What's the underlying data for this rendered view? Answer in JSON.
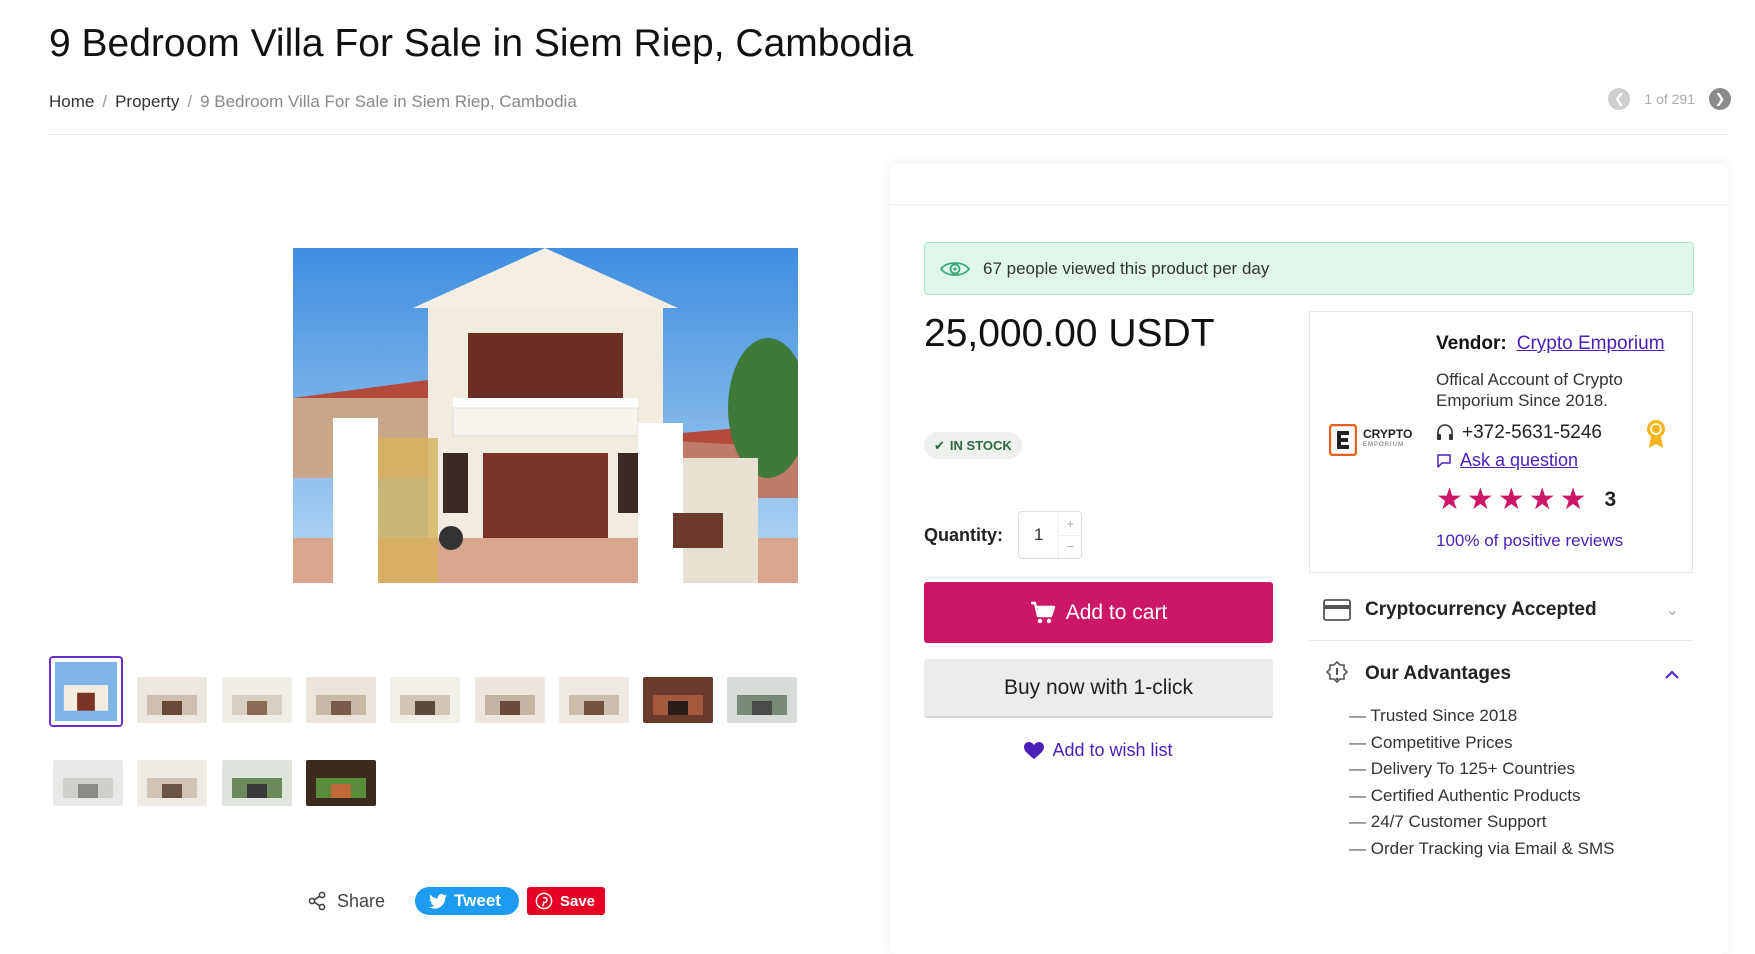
{
  "page": {
    "title": "9 Bedroom Villa For Sale in Siem Riep, Cambodia",
    "breadcrumb": [
      "Home",
      "Property",
      "9 Bedroom Villa For Sale in Siem Riep, Cambodia"
    ],
    "pager": "1 of 291"
  },
  "gallery": {
    "thumb_count": 13,
    "active_index": 0
  },
  "share": {
    "share_label": "Share",
    "tweet_label": "Tweet",
    "save_label": "Save"
  },
  "product": {
    "views_text": "67 people viewed this product per day",
    "price": "25,000.00",
    "currency": "USDT",
    "stock": "IN STOCK",
    "quantity_label": "Quantity:",
    "quantity": "1",
    "add_to_cart": "Add to cart",
    "buy_now": "Buy now with 1-click",
    "wish_list": "Add to wish list"
  },
  "vendor": {
    "label": "Vendor:",
    "name": "Crypto Emporium",
    "description": "Offical Account of Crypto Emporium Since 2018.",
    "phone": "+372-5631-5246",
    "ask": "Ask a question",
    "logo_text": "CRYPTO",
    "logo_subtext": "EMPORIUM",
    "rating_stars": 5,
    "rating_count": "3",
    "positive": "100% of positive reviews"
  },
  "accordion": {
    "crypto_title": "Cryptocurrency Accepted",
    "advantages_title": "Our Advantages",
    "advantages": [
      "Trusted Since 2018",
      "Competitive Prices",
      "Delivery To 125+ Countries",
      "Certified Authentic Products",
      "24/7 Customer Support",
      "Order Tracking via Email & SMS"
    ]
  },
  "colors": {
    "accent": "#cc1766",
    "link": "#4a1fb8",
    "banner_bg": "#dff7ea",
    "active_thumb": "#6a2fc9"
  }
}
